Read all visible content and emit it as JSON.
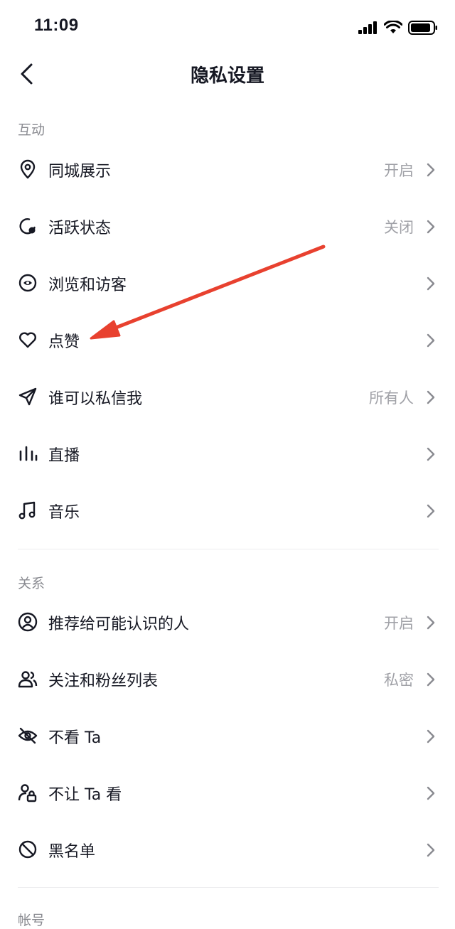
{
  "status_bar": {
    "time": "11:09"
  },
  "header": {
    "title": "隐私设置"
  },
  "sections": [
    {
      "title": "互动"
    },
    {
      "title": "关系"
    },
    {
      "title": "帐号"
    }
  ],
  "interaction_items": [
    {
      "label": "同城展示",
      "value": "开启",
      "icon": "location-pin-icon"
    },
    {
      "label": "活跃状态",
      "value": "关闭",
      "icon": "activity-status-icon"
    },
    {
      "label": "浏览和访客",
      "value": "",
      "icon": "eye-icon"
    },
    {
      "label": "点赞",
      "value": "",
      "icon": "heart-icon"
    },
    {
      "label": "谁可以私信我",
      "value": "所有人",
      "icon": "send-icon"
    },
    {
      "label": "直播",
      "value": "",
      "icon": "live-bars-icon"
    },
    {
      "label": "音乐",
      "value": "",
      "icon": "music-note-icon"
    }
  ],
  "relation_items": [
    {
      "label": "推荐给可能认识的人",
      "value": "开启",
      "icon": "user-circle-icon"
    },
    {
      "label": "关注和粉丝列表",
      "value": "私密",
      "icon": "users-icon"
    },
    {
      "label": "不看 Ta",
      "value": "",
      "icon": "eye-off-icon"
    },
    {
      "label": "不让 Ta 看",
      "value": "",
      "icon": "user-lock-icon"
    },
    {
      "label": "黑名单",
      "value": "",
      "icon": "block-icon"
    }
  ],
  "colors": {
    "annotation_arrow": "#e8412f",
    "text": "#161823",
    "secondary": "#a0a1a7"
  }
}
